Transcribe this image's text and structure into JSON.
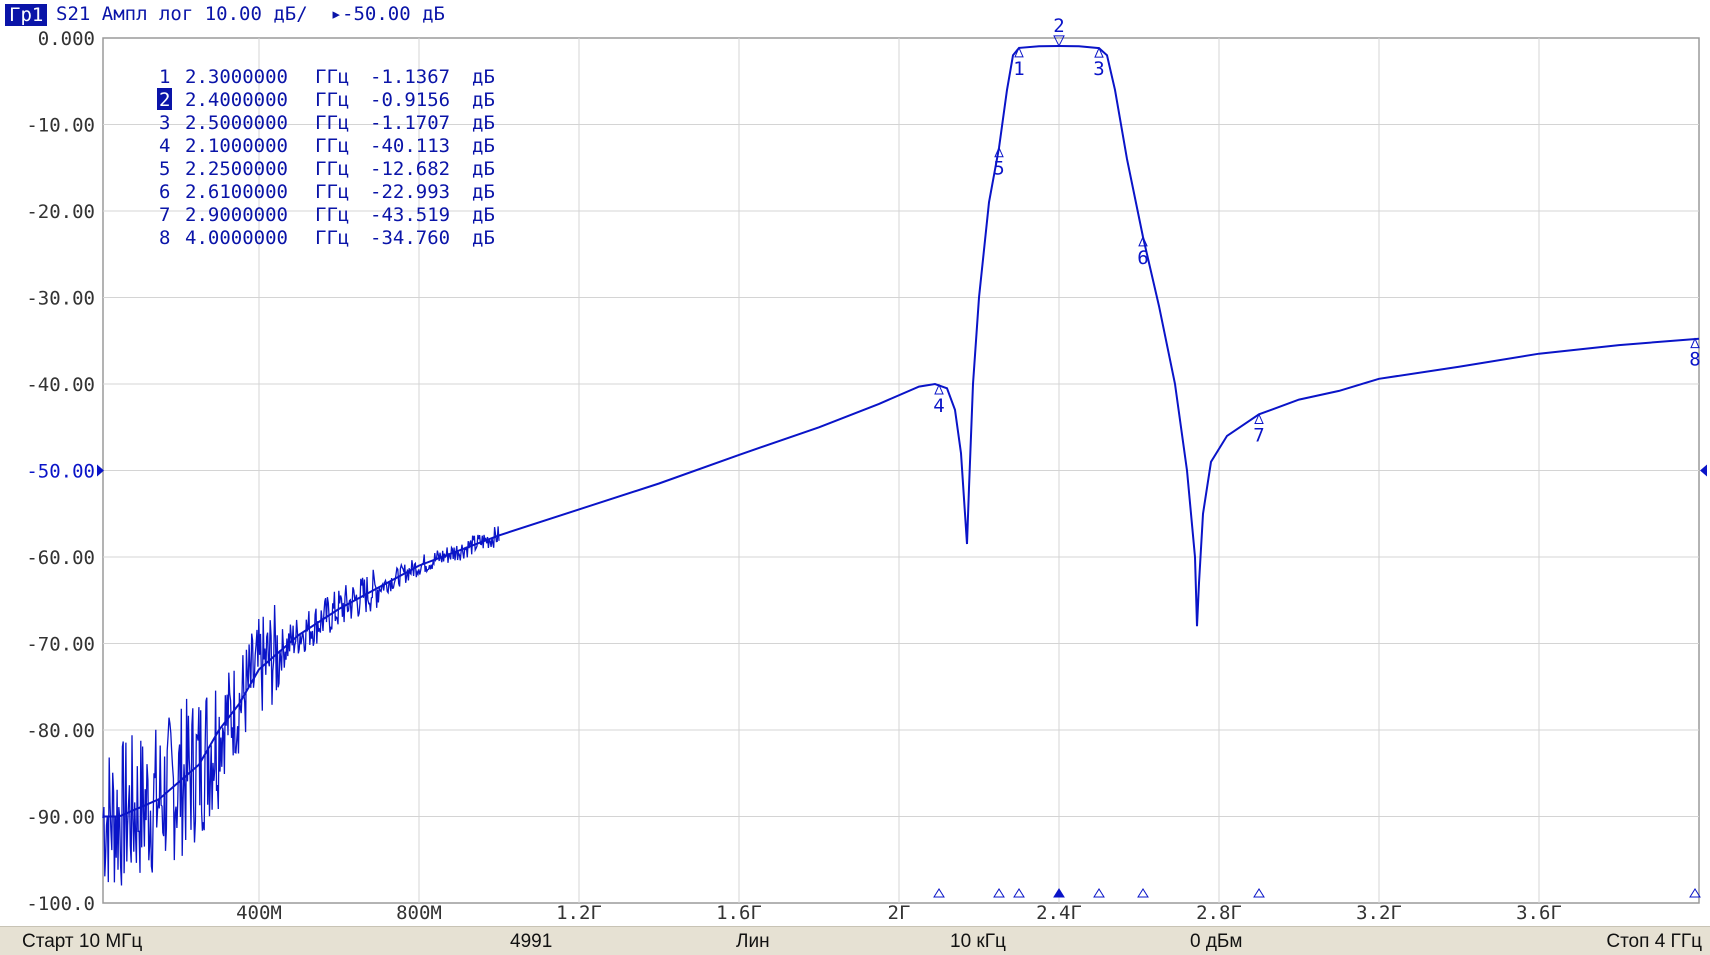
{
  "header": {
    "tag": "Гр1",
    "title_text": "S21 Ампл лог 10.00 дБ/  ",
    "ref_marker": "▸",
    "ref_text": "-50.00 дБ"
  },
  "chart_data": {
    "type": "line",
    "series": [
      {
        "name": "S21",
        "color": "#0a14c8"
      }
    ],
    "ylim": [
      -100,
      0
    ],
    "xlim_ghz": [
      0.01,
      4.0
    ],
    "x_unit": "ГГц",
    "y_unit": "дБ",
    "ytick_labels": [
      "0.000",
      "-10.00",
      "-20.00",
      "-30.00",
      "-40.00",
      "-50.00",
      "-60.00",
      "-70.00",
      "-80.00",
      "-90.00",
      "-100.0"
    ],
    "xtick_values_ghz": [
      0.4,
      0.8,
      1.2,
      1.6,
      2.0,
      2.4,
      2.8,
      3.2,
      3.6
    ],
    "xtick_labels": [
      "400М",
      "800М",
      "1.2Г",
      "1.6Г",
      "2Г",
      "2.4Г",
      "2.8Г",
      "3.2Г",
      "3.6Г"
    ],
    "reference_level": -50.0,
    "grid": true,
    "markers": [
      {
        "id": "1",
        "freq": 2.3,
        "freq_text": "2.3000000",
        "unit": "ГГц",
        "value": -1.1367,
        "value_text": "-1.1367",
        "db": "дБ"
      },
      {
        "id": "2",
        "freq": 2.4,
        "freq_text": "2.4000000",
        "unit": "ГГц",
        "value": -0.9156,
        "value_text": "-0.9156",
        "db": "дБ",
        "active": true
      },
      {
        "id": "3",
        "freq": 2.5,
        "freq_text": "2.5000000",
        "unit": "ГГц",
        "value": -1.1707,
        "value_text": "-1.1707",
        "db": "дБ"
      },
      {
        "id": "4",
        "freq": 2.1,
        "freq_text": "2.1000000",
        "unit": "ГГц",
        "value": -40.113,
        "value_text": "-40.113",
        "db": "дБ"
      },
      {
        "id": "5",
        "freq": 2.25,
        "freq_text": "2.2500000",
        "unit": "ГГц",
        "value": -12.682,
        "value_text": "-12.682",
        "db": "дБ"
      },
      {
        "id": "6",
        "freq": 2.61,
        "freq_text": "2.6100000",
        "unit": "ГГц",
        "value": -22.993,
        "value_text": "-22.993",
        "db": "дБ"
      },
      {
        "id": "7",
        "freq": 2.9,
        "freq_text": "2.9000000",
        "unit": "ГГц",
        "value": -43.519,
        "value_text": "-43.519",
        "db": "дБ"
      },
      {
        "id": "8",
        "freq": 4.0,
        "freq_text": "4.0000000",
        "unit": "ГГц",
        "value": -34.76,
        "value_text": "-34.760",
        "db": "дБ"
      }
    ],
    "trace_points": [
      [
        0.01,
        -90
      ],
      [
        0.05,
        -90
      ],
      [
        0.1,
        -89
      ],
      [
        0.15,
        -88
      ],
      [
        0.2,
        -86
      ],
      [
        0.25,
        -84
      ],
      [
        0.3,
        -80
      ],
      [
        0.35,
        -77
      ],
      [
        0.4,
        -73
      ],
      [
        0.5,
        -69
      ],
      [
        0.6,
        -66
      ],
      [
        0.7,
        -63.5
      ],
      [
        0.8,
        -61
      ],
      [
        1.0,
        -57.5
      ],
      [
        1.2,
        -54.5
      ],
      [
        1.4,
        -51.5
      ],
      [
        1.6,
        -48.2
      ],
      [
        1.8,
        -45
      ],
      [
        1.95,
        -42.3
      ],
      [
        2.05,
        -40.3
      ],
      [
        2.09,
        -40
      ],
      [
        2.12,
        -40.5
      ],
      [
        2.14,
        -43
      ],
      [
        2.155,
        -48
      ],
      [
        2.165,
        -55
      ],
      [
        2.17,
        -58.5
      ],
      [
        2.175,
        -52
      ],
      [
        2.185,
        -40
      ],
      [
        2.2,
        -30
      ],
      [
        2.225,
        -19
      ],
      [
        2.25,
        -12.7
      ],
      [
        2.27,
        -6
      ],
      [
        2.285,
        -2
      ],
      [
        2.3,
        -1.14
      ],
      [
        2.35,
        -0.95
      ],
      [
        2.4,
        -0.92
      ],
      [
        2.45,
        -0.95
      ],
      [
        2.5,
        -1.17
      ],
      [
        2.52,
        -2
      ],
      [
        2.54,
        -6
      ],
      [
        2.57,
        -14
      ],
      [
        2.61,
        -23
      ],
      [
        2.65,
        -31
      ],
      [
        2.69,
        -40
      ],
      [
        2.72,
        -50
      ],
      [
        2.74,
        -60
      ],
      [
        2.745,
        -68
      ],
      [
        2.75,
        -63
      ],
      [
        2.76,
        -55
      ],
      [
        2.78,
        -49
      ],
      [
        2.82,
        -46
      ],
      [
        2.9,
        -43.5
      ],
      [
        3.0,
        -41.8
      ],
      [
        3.1,
        -40.8
      ],
      [
        3.2,
        -39.4
      ],
      [
        3.4,
        -38
      ],
      [
        3.6,
        -36.5
      ],
      [
        3.8,
        -35.5
      ],
      [
        4.0,
        -34.76
      ]
    ]
  },
  "status": {
    "start": "Старт 10 МГц",
    "points": "4991",
    "sweep_type": "Лин",
    "ifbw": "10 кГц",
    "power": "0 дБм",
    "stop": "Стоп 4 ГГц"
  }
}
